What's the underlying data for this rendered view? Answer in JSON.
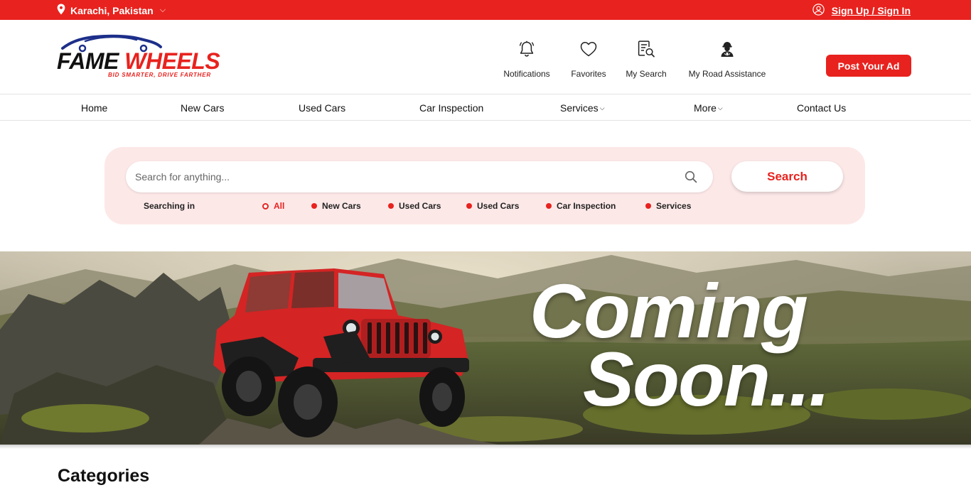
{
  "topbar": {
    "location": "Karachi, Pakistan",
    "location_icon": "map-pin-icon",
    "auth_label": "Sign Up / Sign In",
    "auth_icon": "user-circle-icon"
  },
  "header": {
    "logo": {
      "word1": "FAME",
      "word2": "WHEELS",
      "tagline": "BID SMARTER, DRIVE FARTHER"
    },
    "actions": [
      {
        "label": "Notifications",
        "icon": "bell-icon"
      },
      {
        "label": "Favorites",
        "icon": "heart-icon"
      },
      {
        "label": "My Search",
        "icon": "saved-search-icon"
      },
      {
        "label": "My Road Assistance",
        "icon": "mechanic-icon"
      }
    ],
    "post_ad": "Post Your Ad"
  },
  "nav": {
    "items": [
      {
        "label": "Home"
      },
      {
        "label": "New Cars"
      },
      {
        "label": "Used Cars"
      },
      {
        "label": "Car Inspection"
      },
      {
        "label": "Services",
        "dropdown": true
      },
      {
        "label": "More",
        "dropdown": true
      },
      {
        "label": "Contact Us"
      }
    ]
  },
  "search": {
    "placeholder": "Search for anything...",
    "button": "Search",
    "searching_in_label": "Searching in",
    "options": [
      {
        "label": "All",
        "selected": true
      },
      {
        "label": "New Cars",
        "selected": false
      },
      {
        "label": "Used Cars",
        "selected": false
      },
      {
        "label": "Used Cars",
        "selected": false
      },
      {
        "label": "Car Inspection",
        "selected": false
      },
      {
        "label": "Services",
        "selected": false
      }
    ]
  },
  "banner": {
    "line1": "Coming",
    "line2": "Soon..."
  },
  "sections": {
    "categories_title": "Categories"
  },
  "colors": {
    "brand_red": "#e8221e",
    "search_panel_bg": "#fde8e8"
  }
}
